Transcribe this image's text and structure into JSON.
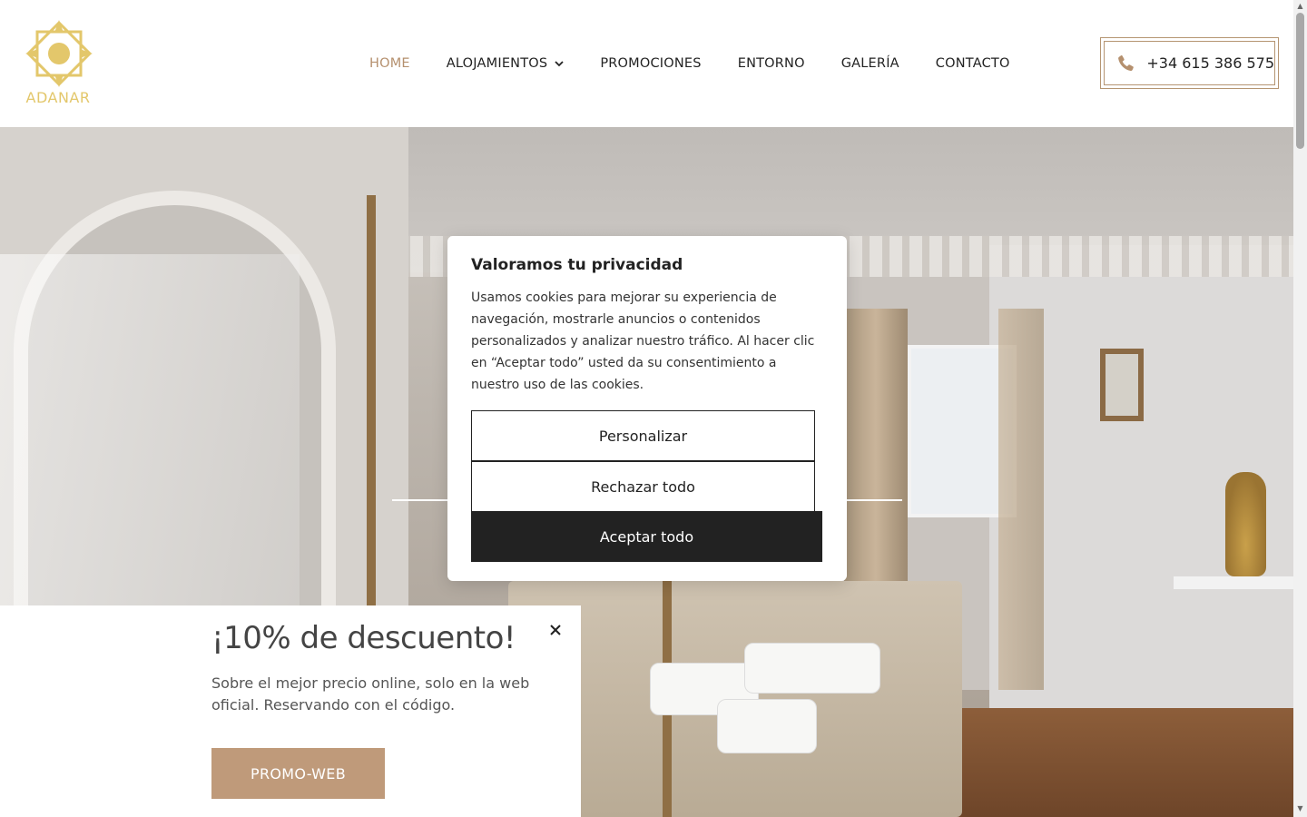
{
  "brand": {
    "name": "ADANAR",
    "accent": "#b5906e",
    "logo_color": "#e3c76b"
  },
  "nav": {
    "items": [
      {
        "label": "HOME",
        "active": true
      },
      {
        "label": "ALOJAMIENTOS",
        "dropdown": true
      },
      {
        "label": "PROMOCIONES"
      },
      {
        "label": "ENTORNO"
      },
      {
        "label": "GALERÍA"
      },
      {
        "label": "CONTACTO"
      }
    ]
  },
  "phone": {
    "icon": "phone-icon",
    "number": "+34 615 386 575"
  },
  "cookie": {
    "title": "Valoramos tu privacidad",
    "body": "Usamos cookies para mejorar su experiencia de navegación, mostrarle anuncios o contenidos personalizados y analizar nuestro tráfico. Al hacer clic en “Aceptar todo” usted da su consentimiento a nuestro uso de las cookies.",
    "customize_label": "Personalizar",
    "reject_label": "Rechazar todo",
    "accept_label": "Aceptar todo"
  },
  "promo": {
    "title": "¡10% de descuento!",
    "text": " Sobre el mejor precio online, solo en la web oficial. Reservando con el código.",
    "code_label": "PROMO-WEB",
    "code_color": "#bf9a7a",
    "close_icon": "close-icon"
  }
}
